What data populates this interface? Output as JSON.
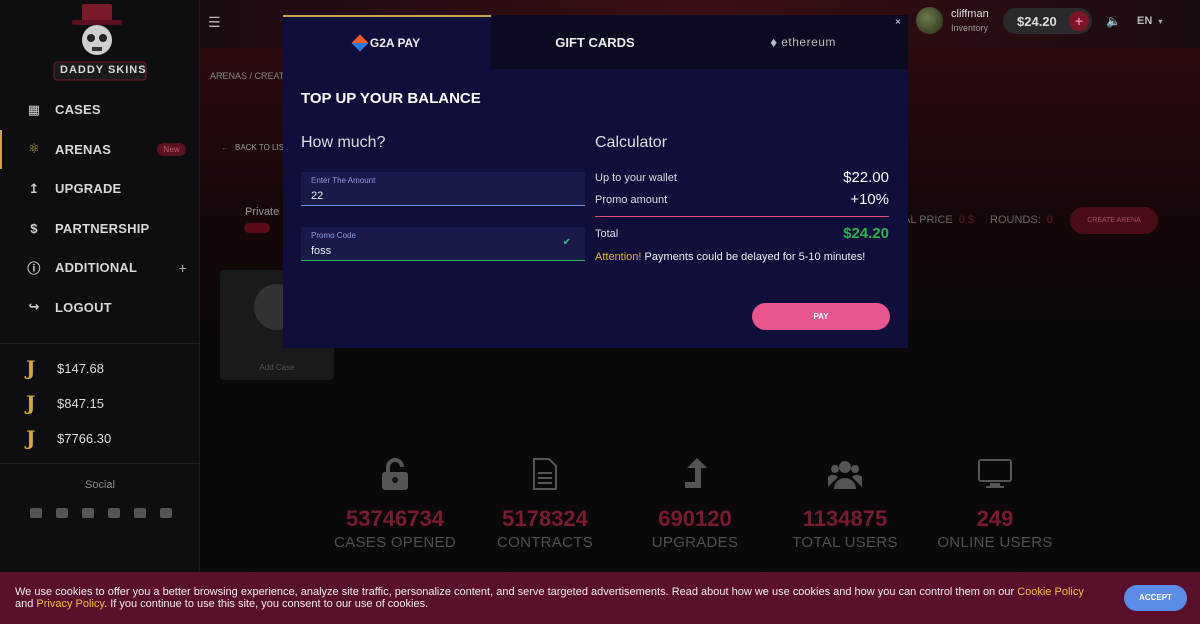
{
  "brand": {
    "name": "DADDY SKINS"
  },
  "sidebar": {
    "items": [
      {
        "label": "CASES",
        "icon": "cases-icon"
      },
      {
        "label": "ARENAS",
        "icon": "arena-icon",
        "badge": "New"
      },
      {
        "label": "UPGRADE",
        "icon": "upgrade-arrow-icon"
      },
      {
        "label": "PARTNERSHIP",
        "icon": "dollar-icon"
      },
      {
        "label": "ADDITIONAL",
        "icon": "info-icon",
        "expand": "+"
      },
      {
        "label": "LOGOUT",
        "icon": "logout-icon"
      }
    ],
    "stats": [
      "$147.68",
      "$847.15",
      "$7766.30"
    ],
    "social_title": "Social"
  },
  "header": {
    "username": "cliffman",
    "inventory_label": "Inventory",
    "balance": "$24.20",
    "language": "EN"
  },
  "page": {
    "breadcrumb": "ARENAS / CREATE",
    "back_label": "BACK TO LIST",
    "private_label": "Private R",
    "add_case_label": "Add Case",
    "total_price_label": "AL PRICE",
    "total_price_value": "0 $",
    "rounds_label": "ROUNDS:",
    "rounds_value": "0",
    "create_arena_label": "CREATE ARENA"
  },
  "modal": {
    "tabs": [
      {
        "label": "G2A PAY"
      },
      {
        "label": "GIFT CARDS"
      },
      {
        "label": "ethereum"
      }
    ],
    "close_label": "×",
    "title": "TOP UP YOUR BALANCE",
    "how_much": "How much?",
    "amount_label": "Enter The Amount",
    "amount_value": "22",
    "promo_label": "Promo Code",
    "promo_value": "foss",
    "calculator_title": "Calculator",
    "wallet_label": "Up to your wallet",
    "wallet_value": "$22.00",
    "promo_amount_label": "Promo amount",
    "promo_amount_value": "+10%",
    "total_label": "Total",
    "total_value": "$24.20",
    "attention_word": "Attention!",
    "attention_text": " Payments could be delayed for 5-10 minutes!",
    "pay_label": "PAY"
  },
  "stats": [
    {
      "value": "53746734",
      "label": "CASES OPENED",
      "icon": "unlock-icon"
    },
    {
      "value": "5178324",
      "label": "CONTRACTS",
      "icon": "document-icon"
    },
    {
      "value": "690120",
      "label": "UPGRADES",
      "icon": "upgrade-arrow-icon"
    },
    {
      "value": "1134875",
      "label": "TOTAL USERS",
      "icon": "users-icon"
    },
    {
      "value": "249",
      "label": "ONLINE USERS",
      "icon": "monitor-icon"
    }
  ],
  "cookie": {
    "text_before": "We use cookies to offer you a better browsing experience, analyze site traffic, personalize content, and serve targeted advertisements. Read about how we use cookies and how you can control them on our ",
    "cookie_policy": "Cookie Policy",
    "and": " and ",
    "privacy_policy": "Privacy Policy",
    "text_after": ". If you continue to use this site, you consent to our use of cookies.",
    "accept_label": "ACCEPT"
  },
  "colors": {
    "accent_pink": "#e9558e",
    "total_green": "#2bb24c",
    "gold": "#c9a34a",
    "modal_bg": "#100e3a"
  }
}
